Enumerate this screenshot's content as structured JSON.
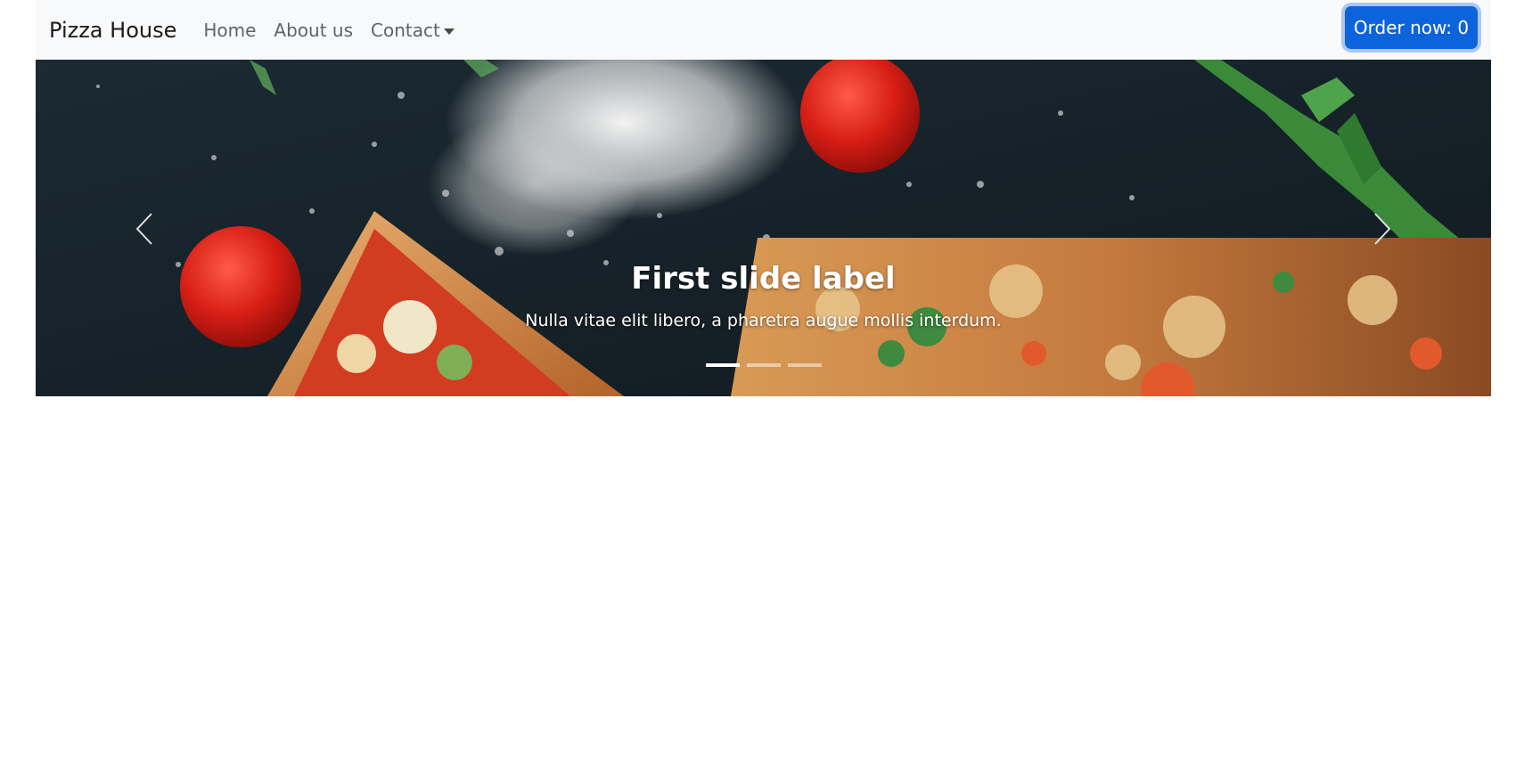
{
  "navbar": {
    "brand": "Pizza House",
    "links": [
      "Home",
      "About us",
      "Contact"
    ],
    "order_button": "Order now: 0"
  },
  "carousel": {
    "image": "pizza-slices-with-tomatoes-and-salt",
    "caption_title": "First slide label",
    "caption_text": "Nulla vitae elit libero, a pharetra augue mollis interdum.",
    "indicator_count": 3,
    "active_index": 0
  },
  "colors": {
    "navbar_bg": "#f8f9fa",
    "button_primary": "#0d63dc"
  }
}
